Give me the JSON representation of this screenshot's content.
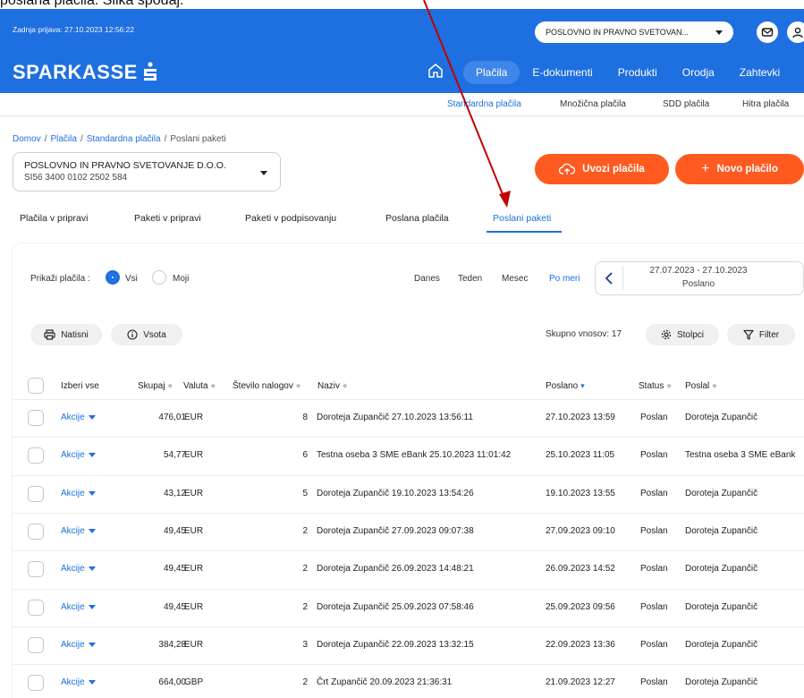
{
  "doc_top_text": "poslana plačila. Slika spodaj:",
  "header": {
    "last_login": "Zadnja prijava: 27.10.2023 12:56:22",
    "org_select": "POSLOVNO IN PRAVNO SVETOVAN...",
    "brand": "SPARKASSE",
    "nav": [
      "Plačila",
      "E-dokumenti",
      "Produkti",
      "Orodja",
      "Zahtevki"
    ],
    "active_nav": "Plačila"
  },
  "subnav": [
    "Standardna plačila",
    "Množična plačila",
    "SDD plačila",
    "Hitra plačila"
  ],
  "breadcrumb": [
    "Domov",
    "Plačila",
    "Standardna plačila",
    "Poslani paketi"
  ],
  "account": {
    "name": "POSLOVNO IN PRAVNO SVETOVANJE D.O.O.",
    "iban": "SI56 3400 0102 2502 584"
  },
  "actions": {
    "import": "Uvozi plačila",
    "new": "Novo plačilo"
  },
  "tabs": [
    "Plačila v pripravi",
    "Paketi v pripravi",
    "Paketi v podpisovanju",
    "Poslana plačila",
    "Poslani paketi"
  ],
  "active_tab": "Poslani paketi",
  "filters": {
    "show_label": "Prikaži plačila :",
    "options": [
      "Vsi",
      "Moji"
    ],
    "selected": "Vsi",
    "periods": [
      "Danes",
      "Teden",
      "Mesec",
      "Po meri"
    ],
    "active_period": "Po meri",
    "date_range": "27.07.2023 - 27.10.2023",
    "date_type": "Poslano"
  },
  "toolbar": {
    "print": "Natisni",
    "sum": "Vsota",
    "total": "Skupno vnosov: 17",
    "columns": "Stolpci",
    "filter": "Filter"
  },
  "table": {
    "headers": {
      "select_all": "Izberi vse",
      "total": "Skupaj",
      "currency": "Valuta",
      "count": "Število nalogov",
      "name": "Naziv",
      "sent": "Poslano",
      "status": "Status",
      "sender": "Poslal"
    },
    "rows": [
      {
        "action": "Akcije",
        "total": "476,01",
        "currency": "EUR",
        "count": "8",
        "name": "Doroteja Zupančič 27.10.2023 13:56:11",
        "sent": "27.10.2023 13:59",
        "status": "Poslan",
        "sender": "Doroteja Zupančič"
      },
      {
        "action": "Akcije",
        "total": "54,77",
        "currency": "EUR",
        "count": "6",
        "name": "Testna oseba 3 SME eBank 25.10.2023 11:01:42",
        "sent": "25.10.2023 11:05",
        "status": "Poslan",
        "sender": "Testna oseba 3 SME eBank"
      },
      {
        "action": "Akcije",
        "total": "43,12",
        "currency": "EUR",
        "count": "5",
        "name": "Doroteja Zupančič 19.10.2023 13:54:26",
        "sent": "19.10.2023 13:55",
        "status": "Poslan",
        "sender": "Doroteja Zupančič"
      },
      {
        "action": "Akcije",
        "total": "49,45",
        "currency": "EUR",
        "count": "2",
        "name": "Doroteja Zupančič 27.09.2023 09:07:38",
        "sent": "27.09.2023 09:10",
        "status": "Poslan",
        "sender": "Doroteja Zupančič"
      },
      {
        "action": "Akcije",
        "total": "49,45",
        "currency": "EUR",
        "count": "2",
        "name": "Doroteja Zupančič 26.09.2023 14:48:21",
        "sent": "26.09.2023 14:52",
        "status": "Poslan",
        "sender": "Doroteja Zupančič"
      },
      {
        "action": "Akcije",
        "total": "49,45",
        "currency": "EUR",
        "count": "2",
        "name": "Doroteja Zupančič 25.09.2023 07:58:46",
        "sent": "25.09.2023 09:56",
        "status": "Poslan",
        "sender": "Doroteja Zupančič"
      },
      {
        "action": "Akcije",
        "total": "384,28",
        "currency": "EUR",
        "count": "3",
        "name": "Doroteja Zupančič 22.09.2023 13:32:15",
        "sent": "22.09.2023 13:36",
        "status": "Poslan",
        "sender": "Doroteja Zupančič"
      },
      {
        "action": "Akcije",
        "total": "664,00",
        "currency": "GBP",
        "count": "2",
        "name": "Črt Zupančič 20.09.2023 21:36:31",
        "sent": "21.09.2023 12:27",
        "status": "Poslan",
        "sender": "Doroteja Zupančič"
      }
    ]
  },
  "colors": {
    "brand_blue": "#1e6fe0",
    "accent_orange": "#ff5a1f",
    "annotation_arrow": "#c00000"
  }
}
